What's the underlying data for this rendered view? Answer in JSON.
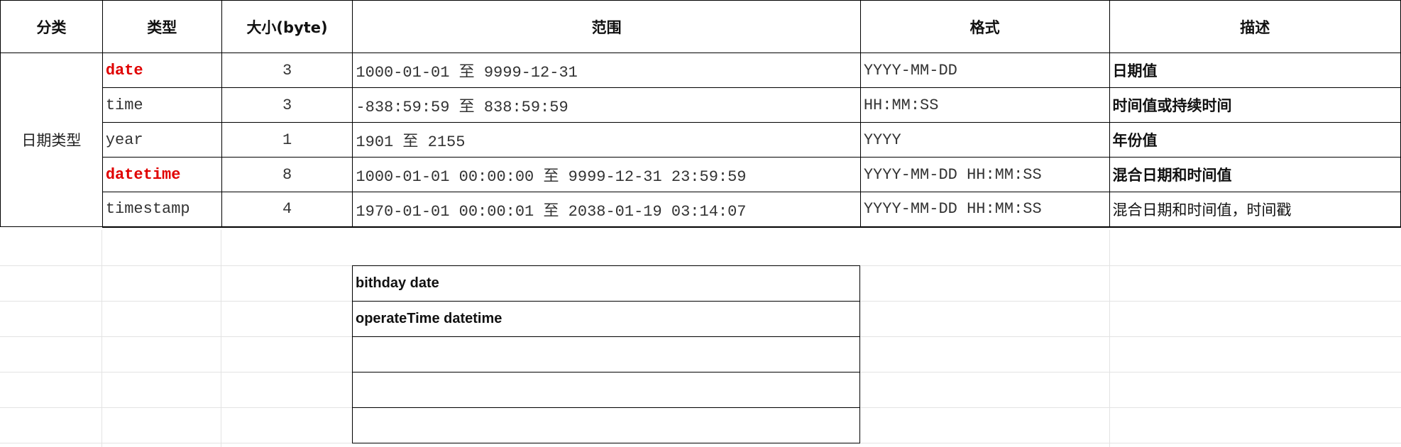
{
  "headers": {
    "category": "分类",
    "type": "类型",
    "size": "大小(byte)",
    "range": "范围",
    "format": "格式",
    "description": "描述"
  },
  "category_label": "日期类型",
  "rows": [
    {
      "type": "date",
      "size": "3",
      "range": "1000-01-01 至 9999-12-31",
      "format": "YYYY-MM-DD",
      "description": "日期值"
    },
    {
      "type": "time",
      "size": "3",
      "range": "-838:59:59 至 838:59:59",
      "format": "HH:MM:SS",
      "description": "时间值或持续时间"
    },
    {
      "type": "year",
      "size": "1",
      "range": "1901 至 2155",
      "format": "YYYY",
      "description": "年份值"
    },
    {
      "type": "datetime",
      "size": "8",
      "range": "1000-01-01 00:00:00 至 9999-12-31 23:59:59",
      "format": "YYYY-MM-DD HH:MM:SS",
      "description": "混合日期和时间值"
    },
    {
      "type": "timestamp",
      "size": "4",
      "range": "1970-01-01 00:00:01 至 2038-01-19 03:14:07",
      "format": "YYYY-MM-DD HH:MM:SS",
      "description": "混合日期和时间值，时间戳"
    }
  ],
  "notes": [
    "bithday date",
    "operateTime datetime",
    "",
    "",
    ""
  ],
  "colors": {
    "highlight_type": "#e00000",
    "border": "#000000",
    "gridline": "#e3e3e3"
  }
}
